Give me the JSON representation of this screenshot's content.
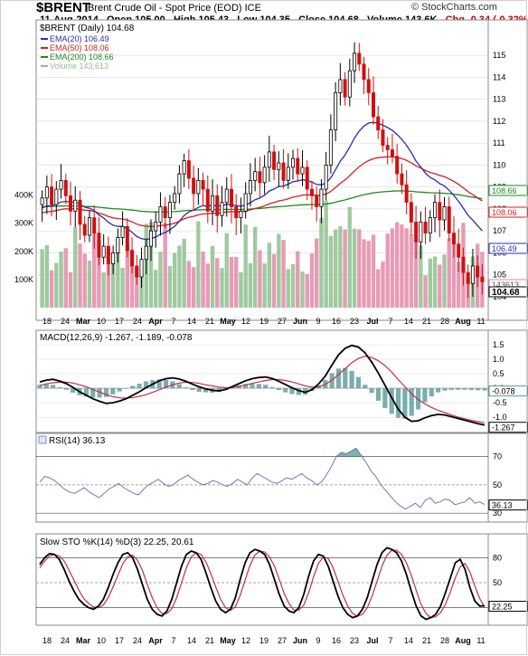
{
  "header": {
    "symbol": "$BRENT",
    "name": "Brent Crude Oil - Spot Price (EOD)",
    "exchange": "ICE",
    "brand": "© StockCharts.com",
    "date": "11-Aug-2014",
    "open": "Open 105.00",
    "high": "High 105.43",
    "low": "Low 104.35",
    "close": "Close 104.68",
    "volume": "Volume 143.6K",
    "chg": "Chg -0.34 (-0.32%)"
  },
  "colors": {
    "ema20": "#2b2bb0",
    "ema50": "#d42020",
    "ema200": "#1e8a1e",
    "vol_up": "#8fbf8f",
    "vol_down": "#e38aa8",
    "macd_line": "#000000",
    "macd_signal": "#c0304a",
    "macd_hist": "#5a9a9a",
    "rsi": "#6a7ab8",
    "sto_k": "#000000",
    "sto_d": "#c0304a"
  },
  "chart_data": [
    {
      "type": "candlestick",
      "title": "$BRENT (Daily) 104.68",
      "ylim": [
        103.5,
        116
      ],
      "yticks": [
        104,
        105,
        106,
        107,
        108,
        109,
        110,
        111,
        112,
        113,
        114,
        115
      ],
      "x_ticks": [
        "18",
        "24",
        "Mar",
        "10",
        "17",
        "24",
        "Apr",
        "7",
        "14",
        "21",
        "May",
        "12",
        "19",
        "27",
        "Jun",
        "9",
        "16",
        "23",
        "Jul",
        "7",
        "14",
        "21",
        "28",
        "Aug",
        "11"
      ],
      "series_labels": [
        {
          "name": "EMA(20) 106.49",
          "color_key": "ema20"
        },
        {
          "name": "EMA(50) 108.06",
          "color_key": "ema50"
        },
        {
          "name": "EMA(200) 108.66",
          "color_key": "ema200"
        },
        {
          "name": "Volume 143,613",
          "color_key": "vol_up"
        }
      ],
      "price_tags": [
        {
          "label": "108.66",
          "value": 108.66,
          "color_key": "ema200"
        },
        {
          "label": "108.06",
          "value": 108.06,
          "color_key": "ema50"
        },
        {
          "label": "106.49",
          "value": 106.49,
          "color_key": "ema20"
        },
        {
          "label": "143613",
          "value": 104.82,
          "color_key": "vol_down"
        },
        {
          "label": "104.68",
          "value": 104.68,
          "color_key": "close"
        }
      ],
      "close": [
        108.5,
        109.0,
        108.2,
        108.9,
        109.3,
        108.6,
        107.9,
        108.4,
        107.3,
        106.8,
        107.6,
        106.9,
        105.8,
        106.3,
        105.5,
        106.0,
        106.7,
        107.2,
        106.1,
        105.4,
        104.9,
        105.7,
        106.3,
        107.0,
        107.4,
        108.1,
        107.6,
        108.3,
        108.7,
        109.6,
        110.2,
        109.4,
        108.7,
        109.3,
        108.9,
        107.9,
        108.6,
        107.7,
        108.3,
        108.9,
        108.1,
        107.6,
        107.9,
        108.7,
        109.3,
        109.7,
        109.2,
        109.9,
        110.6,
        109.8,
        110.1,
        109.3,
        109.9,
        110.3,
        109.6,
        109.9,
        108.9,
        108.6,
        108.1,
        108.9,
        110.0,
        111.6,
        113.3,
        113.9,
        113.1,
        114.3,
        115.1,
        114.6,
        113.9,
        113.3,
        112.2,
        111.6,
        110.9,
        110.7,
        110.4,
        109.6,
        109.1,
        108.3,
        107.4,
        106.5,
        107.4,
        106.9,
        107.6,
        108.3,
        107.5,
        108.1,
        106.9,
        106.4,
        105.8,
        105.1,
        104.6,
        105.4,
        104.9,
        104.68
      ],
      "ema20_end": 106.49,
      "ema50_end": 108.06,
      "ema200_end": 108.66,
      "volume_axis": [
        100000,
        200000,
        300000,
        400000
      ],
      "volume_labels": [
        "100K",
        "200K",
        "300K",
        "400K"
      ]
    },
    {
      "type": "line",
      "title": "MACD(12,26,9) -1.267, -1.189, -0.078",
      "ylim": [
        -1.4,
        1.75
      ],
      "yticks": [
        1.5,
        1.0,
        0.5,
        0.0,
        -0.5,
        -1.0
      ],
      "ytick_labels": [
        "1.5",
        "1.0",
        "0.5",
        "0.0",
        "-0.5",
        "-1.0"
      ],
      "tags": [
        {
          "label": "-0.078",
          "value": -0.078
        },
        {
          "label": "-1.267",
          "value": -1.267
        }
      ],
      "macd": [
        0.22,
        0.28,
        0.31,
        0.25,
        0.16,
        0.03,
        -0.12,
        -0.24,
        -0.36,
        -0.45,
        -0.52,
        -0.5,
        -0.44,
        -0.36,
        -0.24,
        -0.12,
        0.02,
        0.14,
        0.26,
        0.33,
        0.36,
        0.32,
        0.24,
        0.14,
        0.05,
        -0.02,
        -0.07,
        -0.09,
        -0.04,
        0.06,
        0.16,
        0.26,
        0.33,
        0.37,
        0.39,
        0.34,
        0.24,
        0.13,
        0.02,
        -0.08,
        -0.14,
        -0.05,
        0.15,
        0.42,
        0.8,
        1.15,
        1.38,
        1.48,
        1.42,
        1.22,
        0.9,
        0.52,
        0.1,
        -0.32,
        -0.72,
        -1.0,
        -1.14,
        -1.12,
        -1.02,
        -0.94,
        -0.9,
        -0.92,
        -0.98,
        -1.04,
        -1.1,
        -1.16,
        -1.22,
        -1.267
      ],
      "signal": [
        0.1,
        0.15,
        0.19,
        0.21,
        0.21,
        0.18,
        0.12,
        0.05,
        -0.04,
        -0.13,
        -0.22,
        -0.29,
        -0.33,
        -0.34,
        -0.32,
        -0.28,
        -0.22,
        -0.14,
        -0.05,
        0.04,
        0.12,
        0.18,
        0.21,
        0.2,
        0.17,
        0.12,
        0.08,
        0.04,
        0.02,
        0.03,
        0.06,
        0.11,
        0.17,
        0.22,
        0.27,
        0.3,
        0.3,
        0.27,
        0.22,
        0.15,
        0.08,
        0.04,
        0.05,
        0.13,
        0.28,
        0.47,
        0.68,
        0.88,
        1.03,
        1.1,
        1.06,
        0.95,
        0.78,
        0.56,
        0.3,
        0.05,
        -0.19,
        -0.39,
        -0.54,
        -0.66,
        -0.76,
        -0.84,
        -0.92,
        -0.99,
        -1.05,
        -1.1,
        -1.15,
        -1.189
      ]
    },
    {
      "type": "line",
      "title": "RSI(14) 36.13",
      "ylim": [
        25,
        80
      ],
      "yticks": [
        70,
        50,
        30
      ],
      "tags": [
        {
          "label": "36.13",
          "value": 36.13
        }
      ],
      "values": [
        52,
        56,
        55,
        53,
        50,
        47,
        45,
        44,
        46,
        48,
        45,
        43,
        41,
        44,
        47,
        49,
        51,
        48,
        46,
        44,
        43,
        47,
        50,
        52,
        54,
        51,
        49,
        50,
        53,
        55,
        57,
        54,
        52,
        50,
        51,
        53,
        52,
        50,
        49,
        51,
        54,
        52,
        50,
        55,
        58,
        56,
        54,
        52,
        51,
        53,
        55,
        54,
        56,
        58,
        55,
        53,
        50,
        52,
        57,
        63,
        70,
        73,
        72,
        74,
        76,
        71,
        66,
        60,
        56,
        50,
        46,
        42,
        38,
        35,
        33,
        35,
        37,
        34,
        39,
        41,
        37,
        38,
        40,
        39,
        36,
        37,
        38,
        41,
        37,
        38,
        36.13
      ]
    },
    {
      "type": "line",
      "title": "Slow STO %K(14) %D(3) 22.25, 20.61",
      "ylim": [
        0,
        100
      ],
      "yticks": [
        80,
        50,
        20
      ],
      "tags": [
        {
          "label": "22.25",
          "value": 22.25
        }
      ],
      "k": [
        72,
        80,
        85,
        84,
        78,
        66,
        52,
        40,
        30,
        24,
        20,
        18,
        22,
        30,
        44,
        60,
        74,
        84,
        86,
        80,
        66,
        48,
        30,
        18,
        12,
        10,
        16,
        30,
        50,
        70,
        84,
        88,
        86,
        78,
        62,
        44,
        28,
        18,
        14,
        18,
        32,
        54,
        74,
        86,
        90,
        88,
        84,
        72,
        54,
        36,
        22,
        16,
        14,
        20,
        36,
        58,
        76,
        84,
        82,
        70,
        52,
        34,
        20,
        12,
        8,
        10,
        18,
        32,
        52,
        72,
        86,
        92,
        90,
        86,
        76,
        60,
        40,
        22,
        10,
        6,
        8,
        12,
        22,
        38,
        56,
        74,
        78,
        66,
        44,
        28,
        22,
        22.25
      ],
      "d": [
        68,
        76,
        82,
        84,
        82,
        76,
        65,
        53,
        41,
        31,
        25,
        21,
        20,
        23,
        32,
        45,
        59,
        73,
        81,
        83,
        77,
        65,
        48,
        32,
        20,
        13,
        13,
        19,
        32,
        50,
        68,
        81,
        86,
        84,
        75,
        61,
        45,
        30,
        20,
        17,
        21,
        35,
        53,
        71,
        83,
        88,
        87,
        81,
        70,
        54,
        37,
        25,
        17,
        17,
        23,
        38,
        57,
        73,
        81,
        79,
        68,
        52,
        35,
        22,
        13,
        10,
        12,
        20,
        34,
        52,
        70,
        83,
        89,
        89,
        84,
        74,
        59,
        41,
        24,
        13,
        8,
        9,
        14,
        24,
        39,
        56,
        69,
        73,
        63,
        46,
        31,
        20.61
      ]
    }
  ]
}
